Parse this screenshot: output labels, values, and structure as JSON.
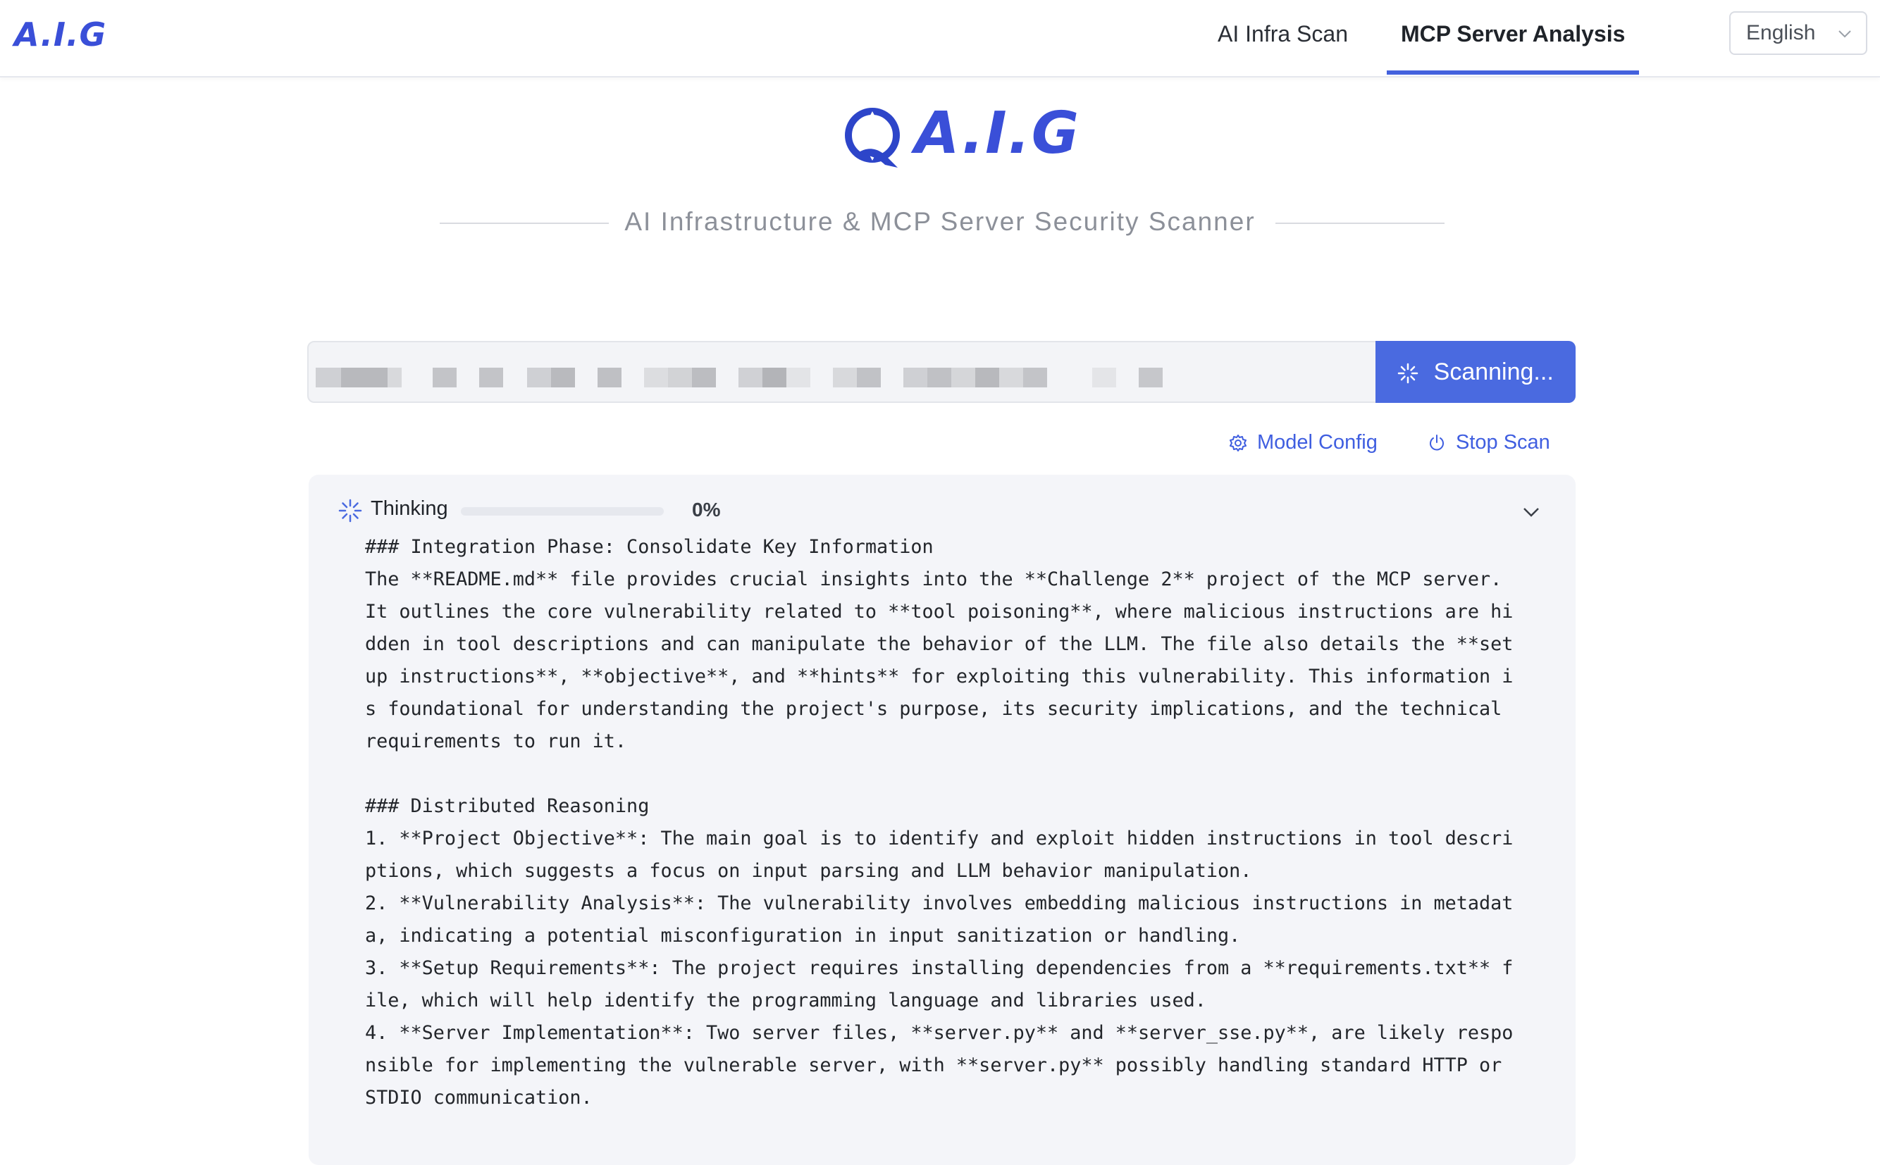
{
  "header": {
    "brand": "A.I.G",
    "tabs": [
      {
        "label": "AI Infra Scan",
        "active": false
      },
      {
        "label": "MCP Server Analysis",
        "active": true
      }
    ],
    "language": "English"
  },
  "hero": {
    "logo_text": "A.I.G",
    "subtitle": "AI Infrastructure & MCP Server Security Scanner"
  },
  "search": {
    "value": "",
    "button_label": "Scanning..."
  },
  "actions": {
    "model_config": "Model Config",
    "stop_scan": "Stop Scan"
  },
  "thinking": {
    "label": "Thinking",
    "progress": 0,
    "progress_text": "0%",
    "content": "### Integration Phase: Consolidate Key Information\nThe **README.md** file provides crucial insights into the **Challenge 2** project of the MCP server. It outlines the core vulnerability related to **tool poisoning**, where malicious instructions are hidden in tool descriptions and can manipulate the behavior of the LLM. The file also details the **setup instructions**, **objective**, and **hints** for exploiting this vulnerability. This information is foundational for understanding the project's purpose, its security implications, and the technical requirements to run it.\n\n### Distributed Reasoning\n1. **Project Objective**: The main goal is to identify and exploit hidden instructions in tool descriptions, which suggests a focus on input parsing and LLM behavior manipulation.\n2. **Vulnerability Analysis**: The vulnerability involves embedding malicious instructions in metadata, indicating a potential misconfiguration in input sanitization or handling.\n3. **Setup Requirements**: The project requires installing dependencies from a **requirements.txt** file, which will help identify the programming language and libraries used.\n4. **Server Implementation**: Two server files, **server.py** and **server_sse.py**, are likely responsible for implementing the vulnerable server, with **server.py** possibly handling standard HTTP or STDIO communication."
  },
  "colors": {
    "accent": "#4361dd",
    "brand": "#3a4fd8",
    "panel_bg": "#f4f5f9"
  }
}
